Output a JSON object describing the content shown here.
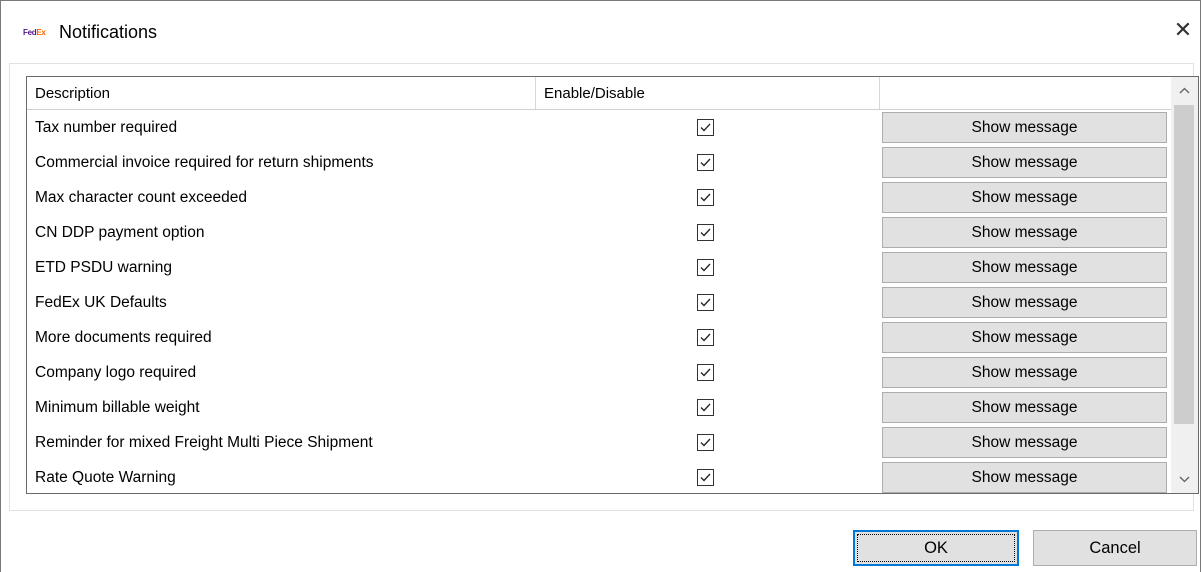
{
  "window": {
    "title": "Notifications",
    "logo_text_fed": "Fed",
    "logo_text_ex": "Ex",
    "close_glyph": "✕"
  },
  "grid": {
    "columns": [
      "Description",
      "Enable/Disable",
      ""
    ],
    "rows": [
      {
        "description": "Tax number required",
        "enabled": true,
        "button": "Show message"
      },
      {
        "description": "Commercial invoice required for return shipments",
        "enabled": true,
        "button": "Show message"
      },
      {
        "description": "Max character count exceeded",
        "enabled": true,
        "button": "Show message"
      },
      {
        "description": "CN DDP payment option",
        "enabled": true,
        "button": "Show message"
      },
      {
        "description": "ETD PSDU warning",
        "enabled": true,
        "button": "Show message"
      },
      {
        "description": "FedEx UK Defaults",
        "enabled": true,
        "button": "Show message"
      },
      {
        "description": "More documents required",
        "enabled": true,
        "button": "Show message"
      },
      {
        "description": "Company logo required",
        "enabled": true,
        "button": "Show message"
      },
      {
        "description": "Minimum billable weight",
        "enabled": true,
        "button": "Show message"
      },
      {
        "description": "Reminder for mixed Freight Multi Piece Shipment",
        "enabled": true,
        "button": "Show message"
      },
      {
        "description": "Rate Quote Warning",
        "enabled": true,
        "button": "Show message"
      }
    ]
  },
  "buttons": {
    "ok_label": "OK",
    "cancel_label": "Cancel"
  },
  "colors": {
    "fedex_purple": "#4d148c",
    "fedex_orange": "#ff6600",
    "focus_blue": "#0078d7",
    "button_face": "#e1e1e1"
  },
  "icons": {
    "close": "close-icon",
    "scroll_up": "chevron-up-icon",
    "scroll_down": "chevron-down-icon",
    "checkbox": "checkbox-checked-icon"
  }
}
